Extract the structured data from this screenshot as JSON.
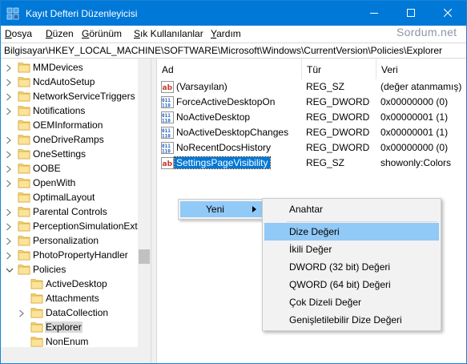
{
  "window": {
    "title": "Kayıt Defteri Düzenleyicisi",
    "accent": "#0078d7"
  },
  "menu": {
    "items": [
      {
        "first": "D",
        "rest": "osya"
      },
      {
        "first": "D",
        "rest": "üzen"
      },
      {
        "first": "G",
        "rest": "örünüm"
      },
      {
        "first": "S",
        "rest": "ık Kullanılanlar"
      },
      {
        "first": "Y",
        "rest": "ardım"
      }
    ],
    "watermark": "Sordum.net"
  },
  "address": "Bilgisayar\\HKEY_LOCAL_MACHINE\\SOFTWARE\\Microsoft\\Windows\\CurrentVersion\\Policies\\Explorer",
  "tree": {
    "items": [
      {
        "label": "MMDevices",
        "level": 0,
        "expander": "collapsed"
      },
      {
        "label": "NcdAutoSetup",
        "level": 0,
        "expander": "collapsed"
      },
      {
        "label": "NetworkServiceTriggers",
        "level": 0,
        "expander": "collapsed"
      },
      {
        "label": "Notifications",
        "level": 0,
        "expander": "collapsed"
      },
      {
        "label": "OEMInformation",
        "level": 0,
        "expander": "none"
      },
      {
        "label": "OneDriveRamps",
        "level": 0,
        "expander": "collapsed"
      },
      {
        "label": "OneSettings",
        "level": 0,
        "expander": "collapsed"
      },
      {
        "label": "OOBE",
        "level": 0,
        "expander": "collapsed"
      },
      {
        "label": "OpenWith",
        "level": 0,
        "expander": "collapsed"
      },
      {
        "label": "OptimalLayout",
        "level": 0,
        "expander": "none"
      },
      {
        "label": "Parental Controls",
        "level": 0,
        "expander": "collapsed"
      },
      {
        "label": "PerceptionSimulationExt",
        "level": 0,
        "expander": "collapsed"
      },
      {
        "label": "Personalization",
        "level": 0,
        "expander": "collapsed"
      },
      {
        "label": "PhotoPropertyHandler",
        "level": 0,
        "expander": "collapsed"
      },
      {
        "label": "Policies",
        "level": 0,
        "expander": "expanded"
      },
      {
        "label": "ActiveDesktop",
        "level": 1,
        "expander": "none"
      },
      {
        "label": "Attachments",
        "level": 1,
        "expander": "none"
      },
      {
        "label": "DataCollection",
        "level": 1,
        "expander": "collapsed"
      },
      {
        "label": "Explorer",
        "level": 1,
        "expander": "none",
        "selected": true
      },
      {
        "label": "NonEnum",
        "level": 1,
        "expander": "none"
      }
    ]
  },
  "values": {
    "headers": {
      "name": "Ad",
      "type": "Tür",
      "data": "Veri"
    },
    "rows": [
      {
        "name": "(Varsayılan)",
        "type": "REG_SZ",
        "data": "(değer atanmamış)",
        "icon": "string-value-icon"
      },
      {
        "name": "ForceActiveDesktopOn",
        "type": "REG_DWORD",
        "data": "0x00000000 (0)",
        "icon": "dword-value-icon"
      },
      {
        "name": "NoActiveDesktop",
        "type": "REG_DWORD",
        "data": "0x00000001 (1)",
        "icon": "dword-value-icon"
      },
      {
        "name": "NoActiveDesktopChanges",
        "type": "REG_DWORD",
        "data": "0x00000001 (1)",
        "icon": "dword-value-icon"
      },
      {
        "name": "NoRecentDocsHistory",
        "type": "REG_DWORD",
        "data": "0x00000000 (0)",
        "icon": "dword-value-icon"
      },
      {
        "name": "SettingsPageVisibility",
        "type": "REG_SZ",
        "data": "showonly:Colors",
        "icon": "string-value-icon",
        "selected": true
      }
    ]
  },
  "context_menu": {
    "new_label": "Yeni",
    "submenu": {
      "key_label": "Anahtar",
      "items": [
        "Dize Değeri",
        "İkili Değer",
        "DWORD (32 bit) Değeri",
        "QWORD (64 bit) Değeri",
        "Çok Dizeli Değer",
        "Genişletilebilir Dize Değeri"
      ],
      "highlighted": "Dize Değeri"
    }
  }
}
